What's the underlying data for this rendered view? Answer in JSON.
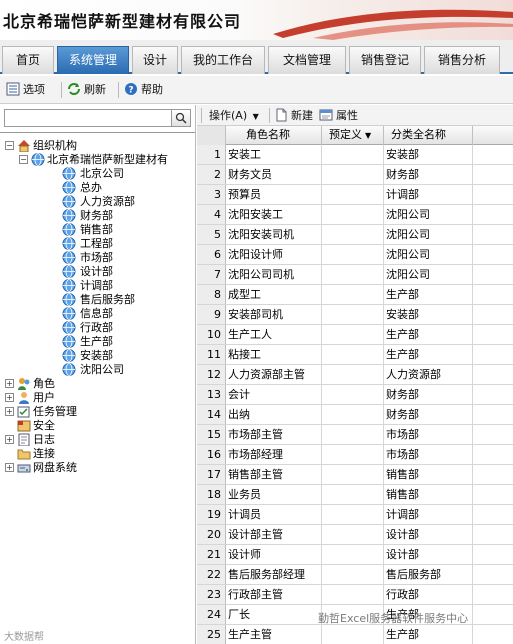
{
  "header": {
    "title": "北京希瑞恺萨新型建材有限公司"
  },
  "tabs": [
    {
      "label": "首页",
      "active": false
    },
    {
      "label": "系统管理",
      "active": true
    },
    {
      "label": "设计",
      "active": false
    },
    {
      "label": "我的工作台",
      "active": false
    },
    {
      "label": "文档管理",
      "active": false
    },
    {
      "label": "销售登记",
      "active": false
    },
    {
      "label": "销售分析",
      "active": false
    }
  ],
  "toolbar": {
    "options_label": "选项",
    "refresh_label": "刷新",
    "help_label": "帮助"
  },
  "search": {
    "value": "",
    "placeholder": ""
  },
  "tree": {
    "org": "组织机构",
    "company": "北京希瑞恺萨新型建材有",
    "departments": [
      "北京公司",
      "总办",
      "人力资源部",
      "财务部",
      "销售部",
      "工程部",
      "市场部",
      "设计部",
      "计调部",
      "售后服务部",
      "信息部",
      "行政部",
      "生产部",
      "安装部",
      "沈阳公司"
    ],
    "others": [
      "角色",
      "用户",
      "任务管理",
      "安全",
      "日志",
      "连接",
      "网盘系统"
    ]
  },
  "grid_toolbar": {
    "operate_label": "操作(A)",
    "new_label": "新建",
    "props_label": "属性"
  },
  "grid": {
    "columns": [
      "角色名称",
      "预定义",
      "分类全名称"
    ],
    "rows": [
      {
        "num": "1",
        "name": "安装工",
        "def": "",
        "cat": "安装部"
      },
      {
        "num": "2",
        "name": "财务文员",
        "def": "",
        "cat": "财务部"
      },
      {
        "num": "3",
        "name": "预算员",
        "def": "",
        "cat": "计调部"
      },
      {
        "num": "4",
        "name": "沈阳安装工",
        "def": "",
        "cat": "沈阳公司"
      },
      {
        "num": "5",
        "name": "沈阳安装司机",
        "def": "",
        "cat": "沈阳公司"
      },
      {
        "num": "6",
        "name": "沈阳设计师",
        "def": "",
        "cat": "沈阳公司"
      },
      {
        "num": "7",
        "name": "沈阳公司司机",
        "def": "",
        "cat": "沈阳公司"
      },
      {
        "num": "8",
        "name": "成型工",
        "def": "",
        "cat": "生产部"
      },
      {
        "num": "9",
        "name": "安装部司机",
        "def": "",
        "cat": "安装部"
      },
      {
        "num": "10",
        "name": "生产工人",
        "def": "",
        "cat": "生产部"
      },
      {
        "num": "11",
        "name": "粘接工",
        "def": "",
        "cat": "生产部"
      },
      {
        "num": "12",
        "name": "人力资源部主管",
        "def": "",
        "cat": "人力资源部"
      },
      {
        "num": "13",
        "name": "会计",
        "def": "",
        "cat": "财务部"
      },
      {
        "num": "14",
        "name": "出纳",
        "def": "",
        "cat": "财务部"
      },
      {
        "num": "15",
        "name": "市场部主管",
        "def": "",
        "cat": "市场部"
      },
      {
        "num": "16",
        "name": "市场部经理",
        "def": "",
        "cat": "市场部"
      },
      {
        "num": "17",
        "name": "销售部主管",
        "def": "",
        "cat": "销售部"
      },
      {
        "num": "18",
        "name": "业务员",
        "def": "",
        "cat": "销售部"
      },
      {
        "num": "19",
        "name": "计调员",
        "def": "",
        "cat": "计调部"
      },
      {
        "num": "20",
        "name": "设计部主管",
        "def": "",
        "cat": "设计部"
      },
      {
        "num": "21",
        "name": "设计师",
        "def": "",
        "cat": "设计部"
      },
      {
        "num": "22",
        "name": "售后服务部经理",
        "def": "",
        "cat": "售后服务部"
      },
      {
        "num": "23",
        "name": "行政部主管",
        "def": "",
        "cat": "行政部"
      },
      {
        "num": "24",
        "name": "厂长",
        "def": "",
        "cat": "生产部"
      },
      {
        "num": "25",
        "name": "生产主管",
        "def": "",
        "cat": "生产部"
      }
    ]
  },
  "watermark": {
    "left": "大数据帮",
    "right": "勤哲Excel服务器软件服务中心"
  },
  "colors": {
    "accent": "#2a6bb2",
    "tab_active": "#3b7fc4",
    "row_number_bg": "#ededed"
  }
}
